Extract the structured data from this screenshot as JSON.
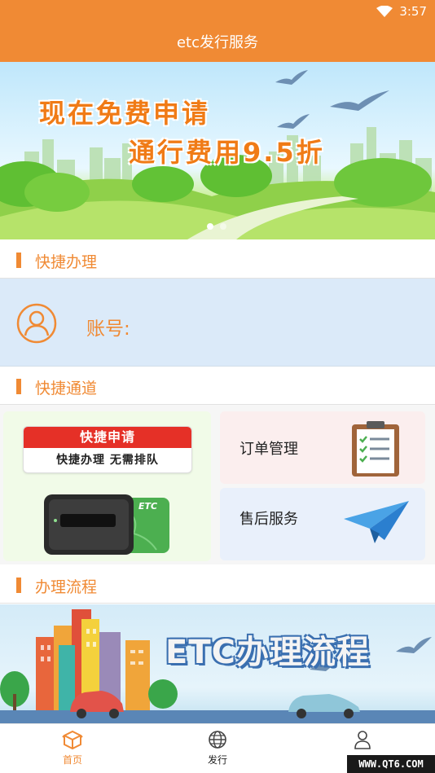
{
  "status_bar": {
    "time": "3:57"
  },
  "header": {
    "title": "etc发行服务"
  },
  "banner": {
    "line1": "现在免费申请",
    "line2": "通行费用9.5折",
    "slide_count": 2,
    "active_slide": 1
  },
  "sections": {
    "quick_handle": "快捷办理",
    "quick_channel": "快捷通道",
    "process": "办理流程"
  },
  "account": {
    "label": "账号:"
  },
  "quick": {
    "apply_title": "快捷申请",
    "apply_sub": "快捷办理 无需排队",
    "device_brand": "ETC",
    "order_label": "订单管理",
    "after_sales_label": "售后服务"
  },
  "process_banner": {
    "text": "ETC办理流程"
  },
  "tabbar": {
    "items": [
      {
        "label": "首页",
        "icon": "box-icon",
        "active": true
      },
      {
        "label": "发行",
        "icon": "globe-icon",
        "active": false
      },
      {
        "label": "",
        "icon": "user-icon",
        "active": false
      }
    ]
  },
  "watermark": "WWW.QT6.COM",
  "colors": {
    "accent": "#f08a34",
    "apply_red": "#e53027",
    "account_bg": "#dbeaf9"
  }
}
